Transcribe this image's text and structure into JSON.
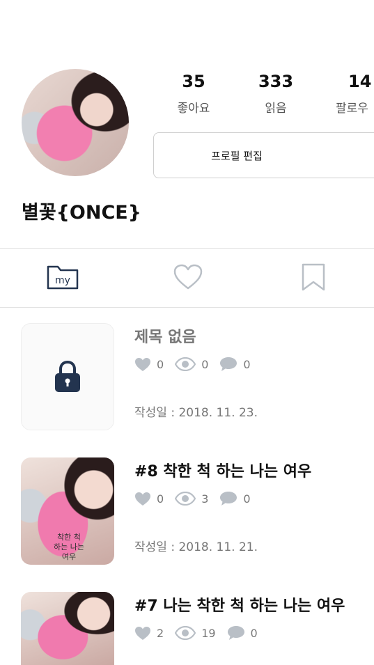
{
  "profile": {
    "username": "별꽃{ONCE}",
    "stats": [
      {
        "value": "35",
        "label": "좋아요"
      },
      {
        "value": "333",
        "label": "읽음"
      },
      {
        "value": "14",
        "label": "팔로우"
      }
    ],
    "edit_button_label": "프로필 편집"
  },
  "tabs": {
    "my_label": "my",
    "icons": [
      "folder-my-icon",
      "heart-icon",
      "bookmark-icon"
    ]
  },
  "posts": [
    {
      "title": "제목 없음",
      "likes": "0",
      "views": "0",
      "comments": "0",
      "date": "작성일 : 2018. 11. 23.",
      "locked": true
    },
    {
      "title": "#8 착한 척 하는 나는 여우",
      "likes": "0",
      "views": "3",
      "comments": "0",
      "date": "작성일 : 2018. 11. 21.",
      "thumb_text": "착한 척\n하는 나는\n여우"
    },
    {
      "title": "#7 나는 착한 척 하는 나는 여우",
      "likes": "2",
      "views": "19",
      "comments": "0"
    }
  ],
  "colors": {
    "icon_dark": "#23344f",
    "icon_grey": "#b9bfc6",
    "divider": "#e2e2e2"
  }
}
